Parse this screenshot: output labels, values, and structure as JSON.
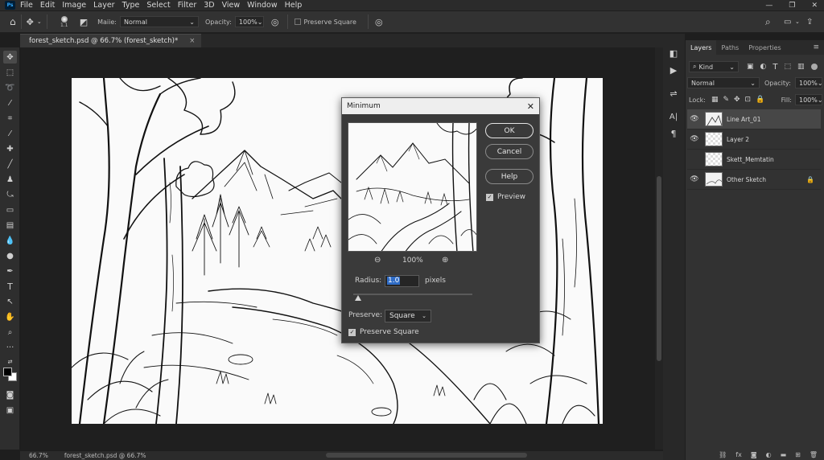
{
  "app": {
    "logo": "Ps",
    "menu": [
      "File",
      "Edit",
      "Image",
      "Layer",
      "Type",
      "Select",
      "Filter",
      "3D",
      "View",
      "Window",
      "Help"
    ]
  },
  "options_bar": {
    "brush_size": "1.1",
    "mode_label": "Maiie:",
    "mode_value": "Normal",
    "opacity_label": "Opacity:",
    "opacity_value": "100%",
    "preserve_label": "Preserve Square"
  },
  "document": {
    "tab_title": "forest_sketch.psd @ 66.7% (forest_sketch)*",
    "close_glyph": "×"
  },
  "status_bar": {
    "zoom": "66.7%",
    "doc_info": "forest_sketch.psd @ 66.7%"
  },
  "layers_panel": {
    "tabs": [
      "Layers",
      "Paths",
      "Properties"
    ],
    "kind_label": "Kind",
    "blend_mode": "Normal",
    "opacity_label": "Opacity:",
    "opacity_value": "100%",
    "lock_label": "Lock:",
    "fill_label": "Fill:",
    "fill_value": "100%",
    "layers": [
      {
        "name": "Line Art_01",
        "visible": true,
        "selected": true
      },
      {
        "name": "Layer 2",
        "visible": true,
        "selected": false
      },
      {
        "name": "Skett_Memtatin",
        "visible": false,
        "selected": false
      },
      {
        "name": "Other Sketch",
        "visible": true,
        "selected": false,
        "locked": true
      }
    ]
  },
  "dialog": {
    "title": "Minimum",
    "ok": "OK",
    "cancel": "Cancel",
    "help": "Help",
    "preview_label": "Preview",
    "preview_checked": true,
    "zoom": "100%",
    "radius_label": "Radius:",
    "radius_value": "1.0",
    "radius_unit": "pixels",
    "preserve_label": "Preserve:",
    "preserve_value": "Square",
    "preserve_square_label": "Preserve Square",
    "preserve_square_checked": true
  }
}
